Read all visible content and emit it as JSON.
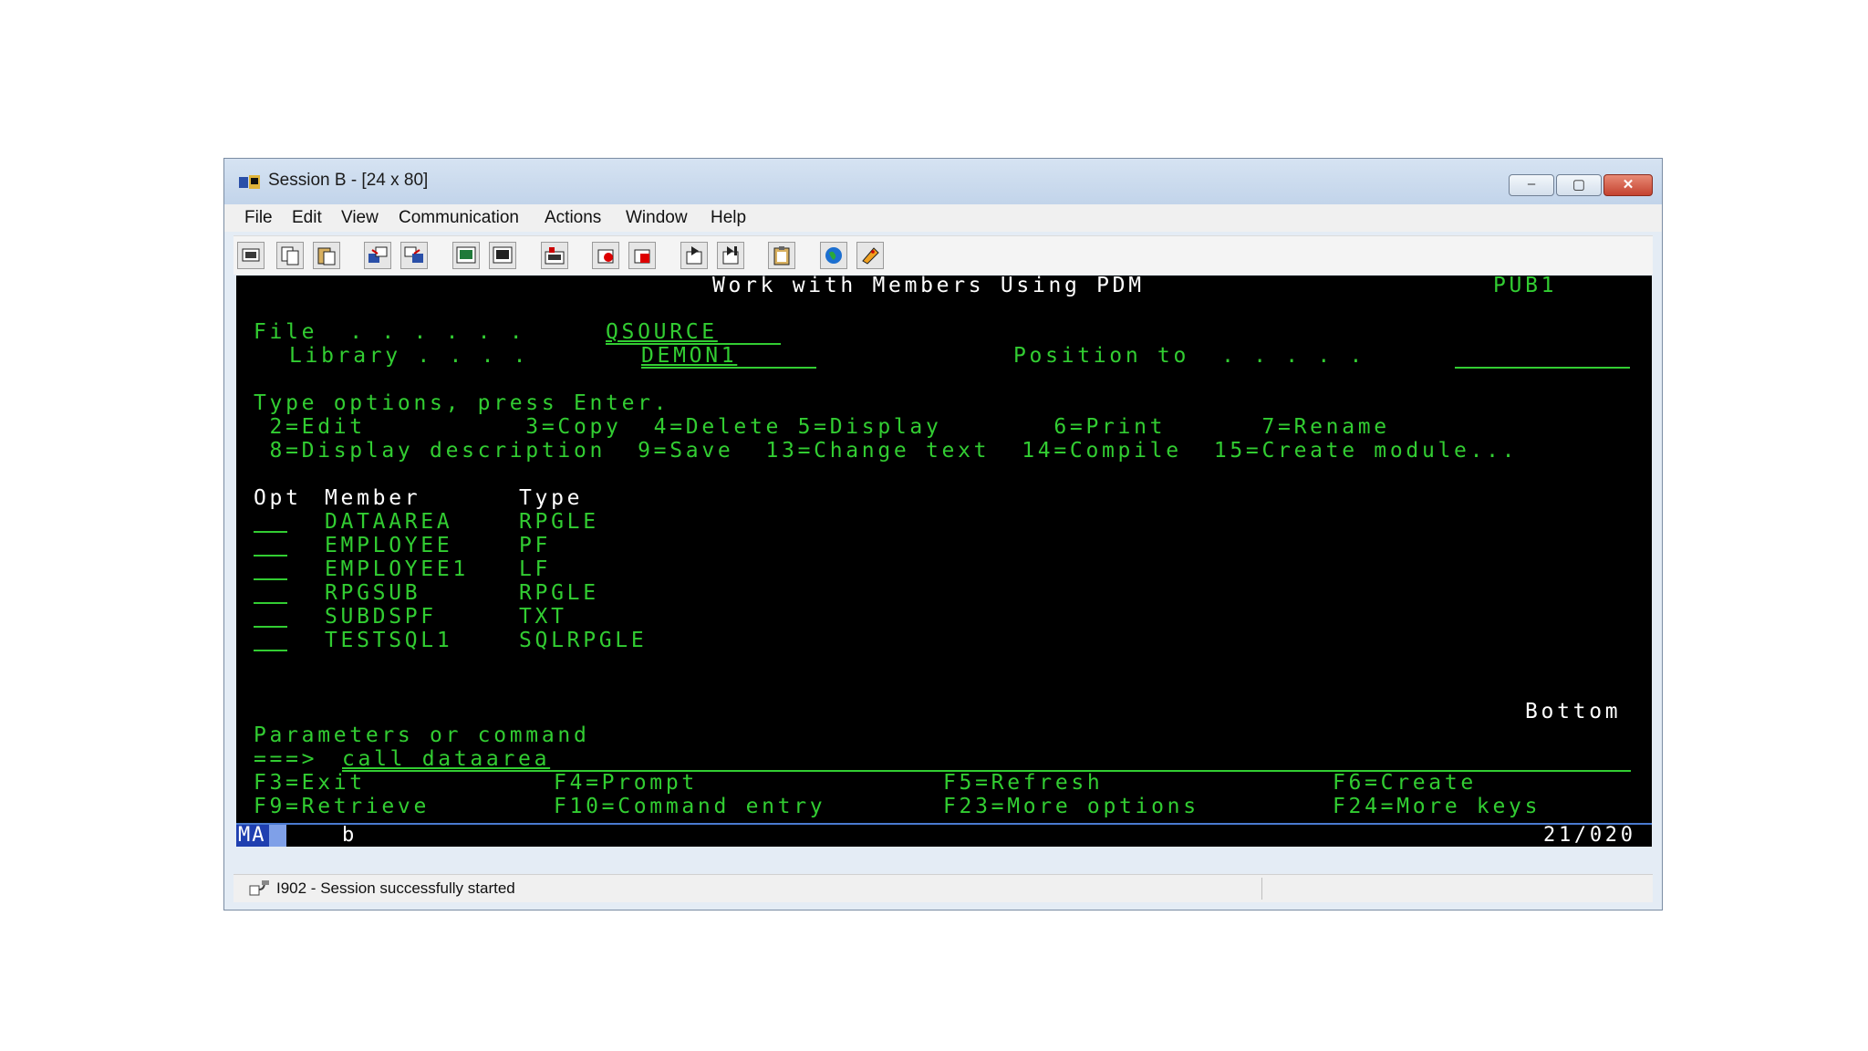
{
  "window": {
    "title": "Session B - [24 x 80]",
    "controls": {
      "minimize": "‒",
      "maximize": "▢",
      "close": "✕"
    }
  },
  "menu": [
    "File",
    "Edit",
    "View",
    "Communication",
    "Actions",
    "Window",
    "Help"
  ],
  "toolbar_icons": [
    "print-screen-icon",
    "copy-icon",
    "paste-icon",
    "send-file-icon",
    "receive-file-icon",
    "display-icon",
    "keypad-icon",
    "macro-icon",
    "record-macro-icon",
    "stop-macro-icon",
    "play-macro-icon",
    "play-step-icon",
    "clipboard-icon",
    "globe-icon",
    "help-icon"
  ],
  "screen": {
    "title": "Work with Members Using PDM",
    "system": "PUB1",
    "file_label": "File  . . . . . .",
    "file_value": "QSOURCE",
    "library_label": "Library . . . .",
    "library_value": "DEMON1",
    "position_label": "Position to  . . . . .",
    "position_value": "",
    "instructions": "Type options, press Enter.",
    "options_line1": " 2=Edit          3=Copy  4=Delete 5=Display       6=Print      7=Rename",
    "options_line2": " 8=Display description  9=Save  13=Change text  14=Compile  15=Create module...",
    "col_opt": "Opt",
    "col_member": "Member",
    "col_type": "Type",
    "members": [
      {
        "member": "DATAAREA",
        "type": "RPGLE"
      },
      {
        "member": "EMPLOYEE",
        "type": "PF"
      },
      {
        "member": "EMPLOYEE1",
        "type": "LF"
      },
      {
        "member": "RPGSUB",
        "type": "RPGLE"
      },
      {
        "member": "SUBDSPF",
        "type": "TXT"
      },
      {
        "member": "TESTSQL1",
        "type": "SQLRPGLE"
      }
    ],
    "bottom": "Bottom",
    "params_label": "Parameters or command",
    "prompt": "===>",
    "command": "call dataarea",
    "fkeys_row1": [
      "F3=Exit",
      "F4=Prompt",
      "F5=Refresh",
      "F6=Create"
    ],
    "fkeys_row2": [
      "F9=Retrieve",
      "F10=Command entry",
      "F23=More options",
      "F24=More keys"
    ]
  },
  "oia": {
    "mode": "MA",
    "session": "b",
    "cursor": "21/020"
  },
  "status": {
    "message": "I902 - Session successfully started"
  },
  "colors": {
    "terminal_bg": "#000000",
    "terminal_green": "#32cd32",
    "terminal_white": "#ffffff",
    "oia_blue": "#1f3fb0"
  }
}
